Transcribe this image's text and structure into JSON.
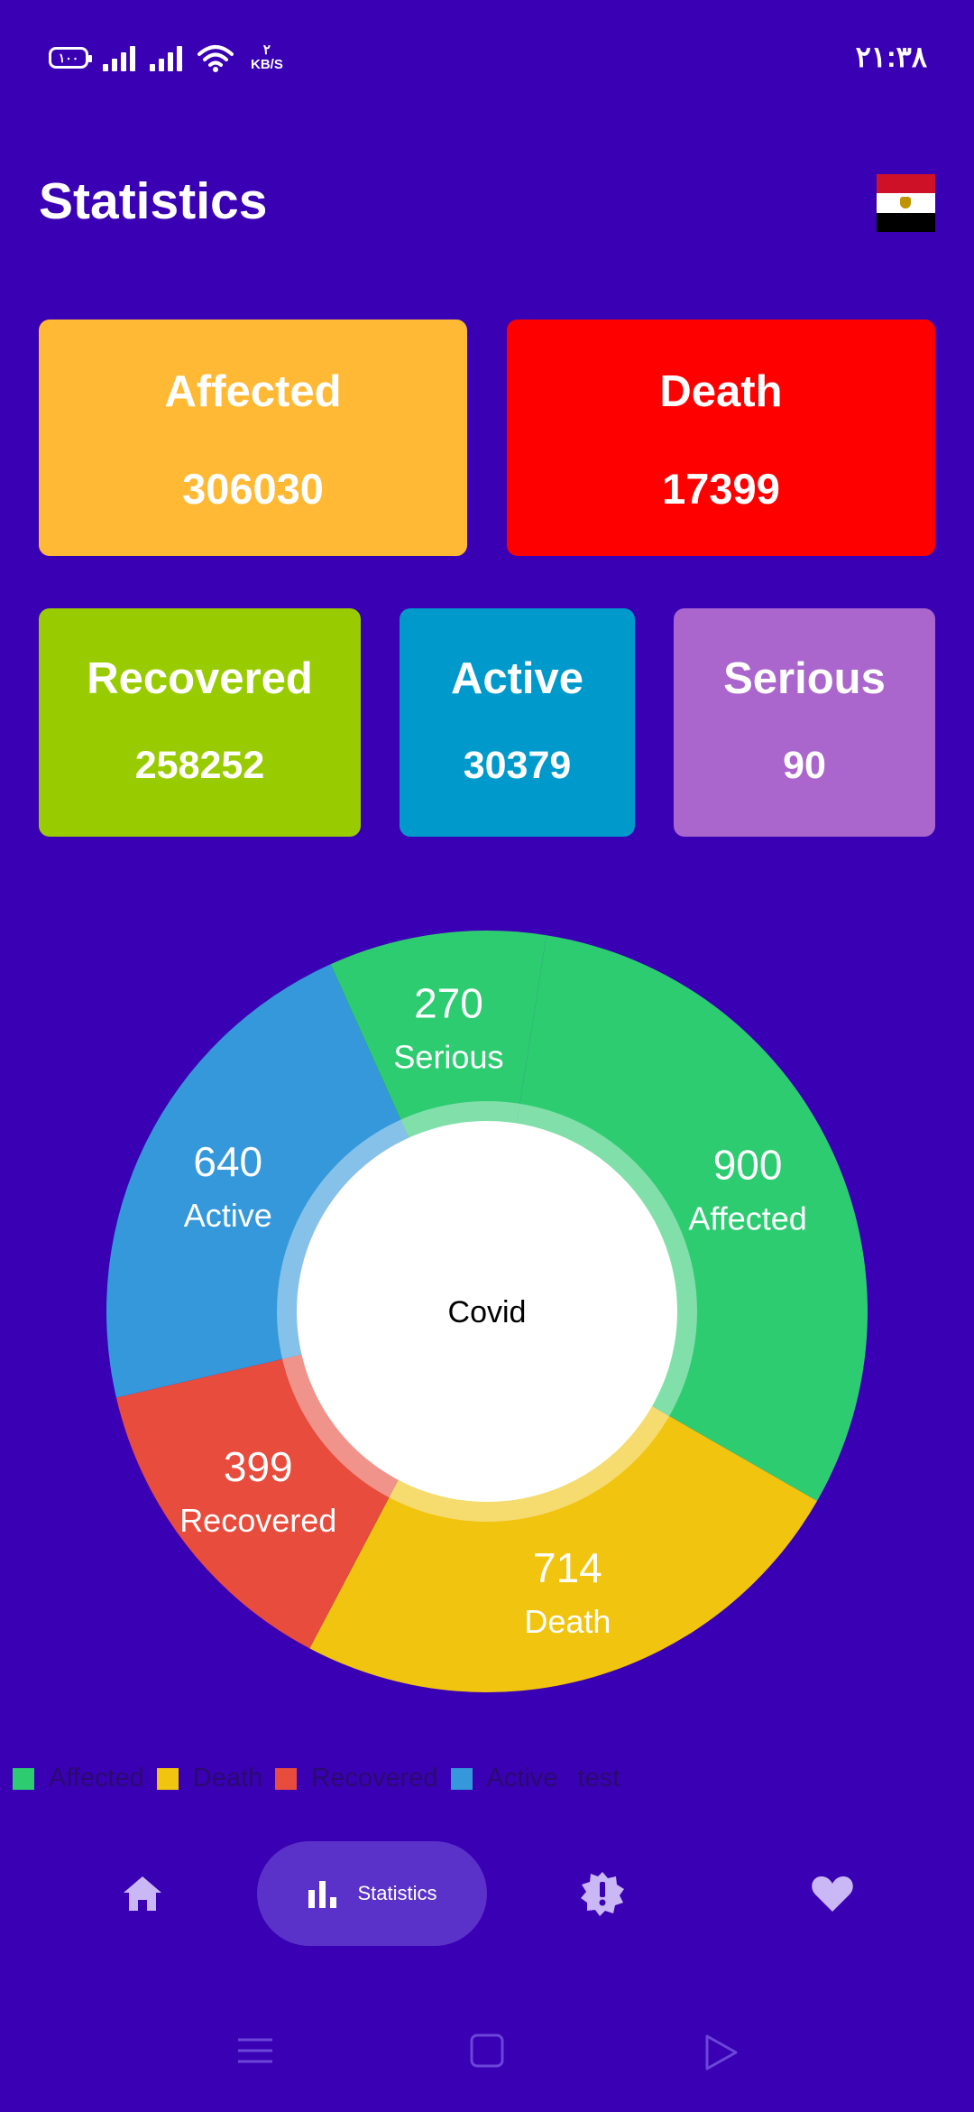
{
  "status_bar": {
    "battery": "١٠٠",
    "speed_value": "٢",
    "speed_unit": "KB/S",
    "time": "٢١:٣٨"
  },
  "header": {
    "title": "Statistics",
    "flag_icon": "egypt-flag-icon"
  },
  "cards": {
    "affected": {
      "label": "Affected",
      "value": "306030",
      "color": "#ffb934"
    },
    "death": {
      "label": "Death",
      "value": "17399",
      "color": "#ff0000"
    },
    "recovered": {
      "label": "Recovered",
      "value": "258252",
      "color": "#99cc00"
    },
    "active": {
      "label": "Active",
      "value": "30379",
      "color": "#0099cc"
    },
    "serious": {
      "label": "Serious",
      "value": "90",
      "color": "#aa66cc"
    }
  },
  "chart_data": {
    "type": "pie",
    "center_text": "Covid",
    "slices": [
      {
        "label": "Affected",
        "value": 900,
        "color": "#2ecc71"
      },
      {
        "label": "Death",
        "value": 714,
        "color": "#f1c40f"
      },
      {
        "label": "Recovered",
        "value": 399,
        "color": "#e74c3c"
      },
      {
        "label": "Active",
        "value": 640,
        "color": "#3498db"
      },
      {
        "label": "Serious",
        "value": 270,
        "color": "#2ecc71"
      }
    ],
    "legend": {
      "placement": "bottom-left",
      "items": [
        {
          "label": "Affected",
          "color": "#2ecc71"
        },
        {
          "label": "Death",
          "color": "#f1c40f"
        },
        {
          "label": "Recovered",
          "color": "#e74c3c"
        },
        {
          "label": "Active",
          "color": "#3498db"
        }
      ],
      "extra_text": "test"
    }
  },
  "bottom_nav": {
    "home_icon": "home-icon",
    "stats_icon": "bar-chart-icon",
    "stats_label": "Statistics",
    "alert_icon": "alert-badge-icon",
    "favorite_icon": "heart-icon",
    "active_bg": "#5b32c9"
  },
  "system_nav": {
    "menu_icon": "menu-icon",
    "home_icon": "square-home-icon",
    "back_icon": "triangle-back-icon"
  }
}
